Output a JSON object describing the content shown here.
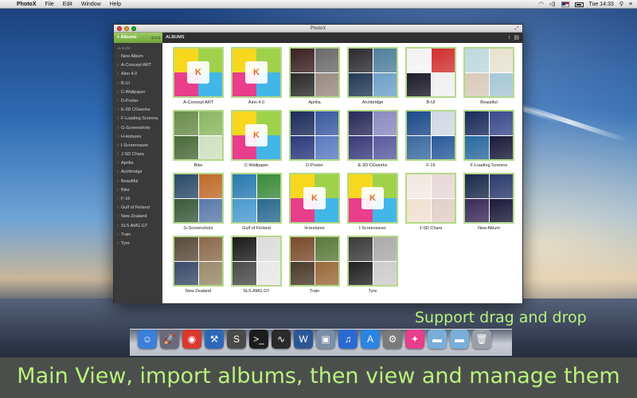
{
  "menubar": {
    "apple": "",
    "items": [
      "PhotoX",
      "File",
      "Edit",
      "Window",
      "Help"
    ],
    "clock": "Tue 14:33"
  },
  "window": {
    "title": "PhotoX",
    "sidebar_button": "+ Albums",
    "section_title": "ALBUMS",
    "sidebar_header": "ALBUM",
    "sidebar_items": [
      "New Album",
      "A-Concept ART",
      "Alon 4.0",
      "B-UI",
      "C-Wallpaper",
      "D-Poster",
      "E-3D CGworks",
      "F-Loading Screens",
      "G-Screenshots",
      "H-textures",
      "I-Screensaver",
      "J-SD Chara",
      "Aprilia",
      "Archbridge",
      "Beautiful",
      "Bike",
      "F-16",
      "Gulf of Finland",
      "New Zealand",
      "SLS AMG GT",
      "Train",
      "Tyre"
    ],
    "albums": [
      {
        "name": "A-Concept ART",
        "kind": "logo"
      },
      {
        "name": "Alon 4.0",
        "kind": "logo"
      },
      {
        "name": "Aprilia",
        "kind": "photo",
        "colors": [
          "#3a2020",
          "#6a6a6a",
          "#2a2a2a",
          "#9a8a80"
        ]
      },
      {
        "name": "Archbridge",
        "kind": "photo",
        "colors": [
          "#2a2a30",
          "#4f7f9c",
          "#233a55",
          "#6fa0c8"
        ]
      },
      {
        "name": "B-UI",
        "kind": "photo",
        "colors": [
          "#f4f4f4",
          "#d13030",
          "#1a1a2a",
          "#f0f0f0"
        ]
      },
      {
        "name": "Beautiful",
        "kind": "photo",
        "colors": [
          "#bcd8de",
          "#e8e2d0",
          "#d9c9b9",
          "#a7c7d6"
        ]
      },
      {
        "name": "Bike",
        "kind": "photo",
        "colors": [
          "#6a8c4a",
          "#8ab660",
          "#4a6a3a",
          "#cfe0c0"
        ]
      },
      {
        "name": "C-Wallpaper",
        "kind": "logo"
      },
      {
        "name": "D-Poster",
        "kind": "photo",
        "colors": [
          "#1a2a5a",
          "#3a5aa0",
          "#2a3a7a",
          "#5a7ac0"
        ]
      },
      {
        "name": "E-3D CGworks",
        "kind": "photo",
        "colors": [
          "#2a2a5a",
          "#8a8ac0",
          "#3a3a7a",
          "#5a5aa0"
        ]
      },
      {
        "name": "F-16",
        "kind": "photo",
        "colors": [
          "#1a4a8a",
          "#d0d8e4",
          "#3a6aa0",
          "#2a5a9a"
        ]
      },
      {
        "name": "F-Loading Screens",
        "kind": "photo",
        "colors": [
          "#1a2a5a",
          "#3a4a8a",
          "#2a6aa0",
          "#1a1a3a"
        ]
      },
      {
        "name": "G-Screenshots",
        "kind": "photo",
        "colors": [
          "#2a4a6a",
          "#c06a2a",
          "#3a5a3a",
          "#5a7aaa"
        ]
      },
      {
        "name": "Gulf of Finland",
        "kind": "photo",
        "colors": [
          "#2a7ab0",
          "#3a8a3a",
          "#4a9ad0",
          "#2a6a90"
        ]
      },
      {
        "name": "H-textures",
        "kind": "logo"
      },
      {
        "name": "I-Screensaver",
        "kind": "logo"
      },
      {
        "name": "J-SD Chara",
        "kind": "photo",
        "colors": [
          "#f2e8e0",
          "#e8d8d8",
          "#f0e0d0",
          "#e0d0c8"
        ]
      },
      {
        "name": "New Album",
        "kind": "photo",
        "colors": [
          "#1a2a4a",
          "#2a3a6a",
          "#3a2a5a",
          "#1a1a3a"
        ]
      },
      {
        "name": "New Zealand",
        "kind": "photo",
        "colors": [
          "#5a4a3a",
          "#8a6a4a",
          "#3a4a6a",
          "#9a8a6a"
        ]
      },
      {
        "name": "SLS AMG GT",
        "kind": "photo",
        "colors": [
          "#1a1a1a",
          "#dcdcdc",
          "#4a4a4a",
          "#e8e8e8"
        ]
      },
      {
        "name": "Train",
        "kind": "photo",
        "colors": [
          "#7a4a2a",
          "#5a7a3a",
          "#4a3a2a",
          "#9a6a3a"
        ]
      },
      {
        "name": "Tyre",
        "kind": "photo",
        "colors": [
          "#3a3a3a",
          "#aaaaaa",
          "#222222",
          "#cccccc"
        ]
      }
    ]
  },
  "dock": {
    "icons": [
      {
        "name": "finder-icon",
        "glyph": "☺",
        "color": "#3b7fd8"
      },
      {
        "name": "launchpad-icon",
        "glyph": "🚀",
        "color": "#6a6a7a"
      },
      {
        "name": "chrome-icon",
        "glyph": "◉",
        "color": "#d8392f"
      },
      {
        "name": "xcode-icon",
        "glyph": "⚒",
        "color": "#2d68b8"
      },
      {
        "name": "sublime-icon",
        "glyph": "S",
        "color": "#4a4a4a"
      },
      {
        "name": "terminal-icon",
        "glyph": ">_",
        "color": "#1c1c1c"
      },
      {
        "name": "activity-monitor-icon",
        "glyph": "∿",
        "color": "#2a2a2a"
      },
      {
        "name": "word-icon",
        "glyph": "W",
        "color": "#2b5797"
      },
      {
        "name": "preview-icon",
        "glyph": "▣",
        "color": "#7a8ea8"
      },
      {
        "name": "itunes-icon",
        "glyph": "♫",
        "color": "#2a6ad0"
      },
      {
        "name": "app-store-icon",
        "glyph": "A",
        "color": "#2a86e0"
      },
      {
        "name": "system-preferences-icon",
        "glyph": "⚙",
        "color": "#7a7a7a"
      },
      {
        "name": "photox-icon",
        "glyph": "✦",
        "color": "#e83e8c"
      },
      {
        "name": "folder-icon",
        "glyph": "▬",
        "color": "#7aaed8"
      },
      {
        "name": "downloads-folder-icon",
        "glyph": "▬",
        "color": "#7aaed8"
      },
      {
        "name": "trash-icon",
        "glyph": "🗑",
        "color": "#9aa0a8"
      }
    ]
  },
  "captions": {
    "side": "Support drag and drop",
    "bottom": "Main View, import albums, then view and manage them"
  }
}
